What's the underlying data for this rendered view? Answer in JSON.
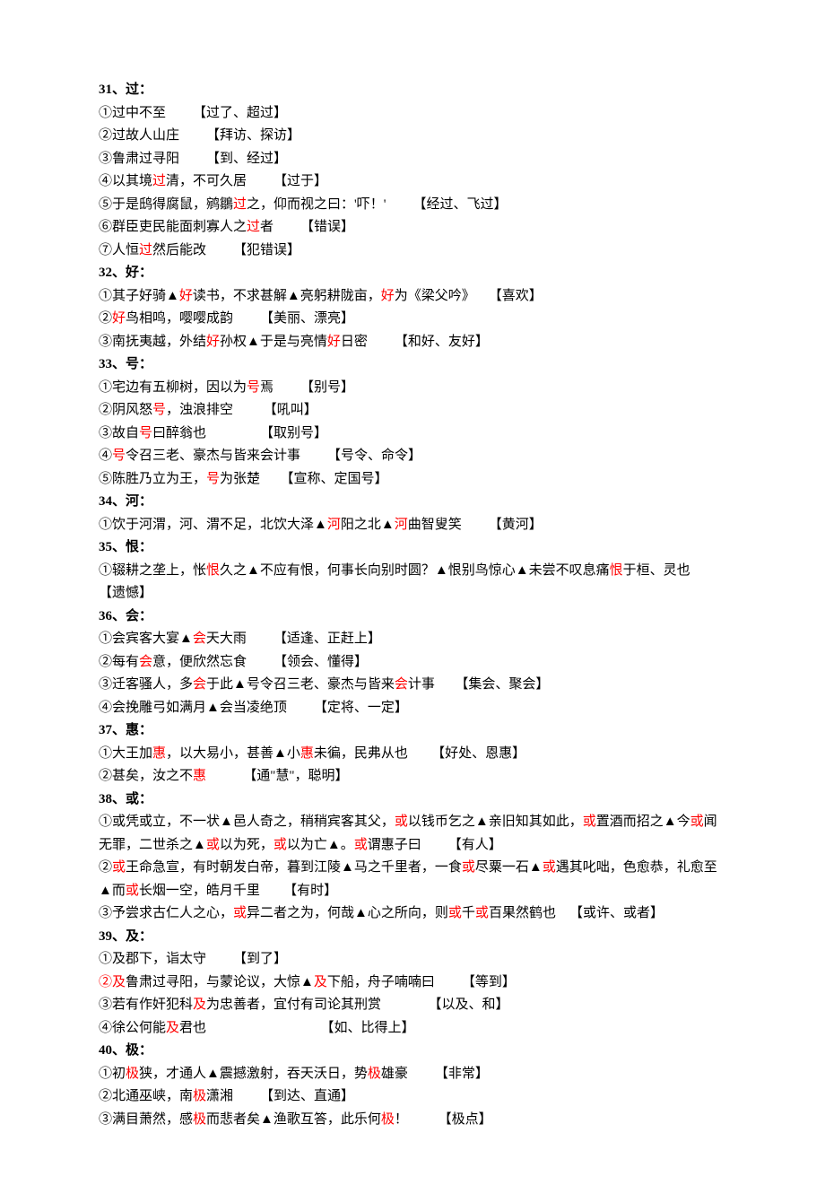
{
  "entries": [
    {
      "head": "31、过：",
      "lines": [
        [
          {
            "t": "①过中不至        【过了、超过】"
          }
        ],
        [
          {
            "t": "②过故人山庄        【拜访、探访】"
          }
        ],
        [
          {
            "t": "③鲁肃过寻阳        【到、经过】"
          }
        ],
        [
          {
            "t": "④以其境"
          },
          {
            "t": "过",
            "hl": true
          },
          {
            "t": "清，不可久居        【过于】"
          }
        ],
        [
          {
            "t": "⑤于是鸱得腐鼠，鹓鶵"
          },
          {
            "t": "过",
            "hl": true
          },
          {
            "t": "之，仰而视之曰：'吓！'        【经过、飞过】"
          }
        ],
        [
          {
            "t": "⑥群臣吏民能面刺寡人之"
          },
          {
            "t": "过",
            "hl": true
          },
          {
            "t": "者        【错误】"
          }
        ],
        [
          {
            "t": "⑦人恒"
          },
          {
            "t": "过",
            "hl": true
          },
          {
            "t": "然后能改        【犯错误】"
          }
        ]
      ]
    },
    {
      "head": "32、好：",
      "lines": [
        [
          {
            "t": "①其子好骑▲"
          },
          {
            "t": "好",
            "hl": true
          },
          {
            "t": "读书，不求甚解▲亮躬耕陇亩，"
          },
          {
            "t": "好",
            "hl": true
          },
          {
            "t": "为《梁父吟》    【喜欢】"
          }
        ],
        [
          {
            "t": "②"
          },
          {
            "t": "好",
            "hl": true
          },
          {
            "t": "鸟相鸣，嘤嘤成韵        【美丽、漂亮】"
          }
        ],
        [
          {
            "t": "③南抚夷越，外结"
          },
          {
            "t": "好",
            "hl": true
          },
          {
            "t": "孙权▲于是与亮情"
          },
          {
            "t": "好",
            "hl": true
          },
          {
            "t": "日密        【和好、友好】"
          }
        ]
      ]
    },
    {
      "head": "33、号：",
      "lines": [
        [
          {
            "t": "①宅边有五柳树，因以为"
          },
          {
            "t": "号",
            "hl": true
          },
          {
            "t": "焉        【别号】"
          }
        ],
        [
          {
            "t": "②阴风怒"
          },
          {
            "t": "号",
            "hl": true
          },
          {
            "t": "，浊浪排空         【吼叫】"
          }
        ],
        [
          {
            "t": "③故自"
          },
          {
            "t": "号",
            "hl": true
          },
          {
            "t": "曰醉翁也                【取别号】"
          }
        ],
        [
          {
            "t": "④"
          },
          {
            "t": "号",
            "hl": true
          },
          {
            "t": "令召三老、豪杰与皆来会计事        【号令、命令】"
          }
        ],
        [
          {
            "t": "⑤陈胜乃立为王，"
          },
          {
            "t": "号",
            "hl": true
          },
          {
            "t": "为张楚      【宣称、定国号】"
          }
        ]
      ]
    },
    {
      "head": "34、河：",
      "lines": [
        [
          {
            "t": "①饮于河渭，河、渭不足，北饮大泽▲"
          },
          {
            "t": "河",
            "hl": true
          },
          {
            "t": "阳之北▲"
          },
          {
            "t": "河",
            "hl": true
          },
          {
            "t": "曲智叟笑        【黄河】"
          }
        ]
      ]
    },
    {
      "head": "35、恨：",
      "lines": [
        [
          {
            "t": "①辍耕之垄上，怅"
          },
          {
            "t": "恨",
            "hl": true
          },
          {
            "t": "久之▲不应有恨，何事长向别时圆？▲恨别鸟惊心▲未尝不叹息痛"
          },
          {
            "t": "恨",
            "hl": true
          },
          {
            "t": "于桓、灵也     【遗憾】"
          }
        ]
      ]
    },
    {
      "head": "36、会：",
      "lines": [
        [
          {
            "t": "①会宾客大宴▲"
          },
          {
            "t": "会",
            "hl": true
          },
          {
            "t": "天大雨        【适逢、正赶上】"
          }
        ],
        [
          {
            "t": "②每有"
          },
          {
            "t": "会",
            "hl": true
          },
          {
            "t": "意，便欣然忘食        【领会、懂得】"
          }
        ],
        [
          {
            "t": "③迁客骚人，多"
          },
          {
            "t": "会",
            "hl": true
          },
          {
            "t": "于此▲号令召三老、豪杰与皆来"
          },
          {
            "t": "会",
            "hl": true
          },
          {
            "t": "计事      【集会、聚会】"
          }
        ],
        [
          {
            "t": "④会挽雕弓如满月▲会当凌绝顶        【定将、一定】"
          }
        ]
      ]
    },
    {
      "head": "37、惠：",
      "lines": [
        [
          {
            "t": "①大王加"
          },
          {
            "t": "惠",
            "hl": true
          },
          {
            "t": "，以大易小，甚善▲小"
          },
          {
            "t": "惠",
            "hl": true
          },
          {
            "t": "未徧，民弗从也       【好处、恩惠】"
          }
        ],
        [
          {
            "t": "②甚矣，汝之不"
          },
          {
            "t": "惠",
            "hl": true
          },
          {
            "t": "           【通\"慧\"，聪明】"
          }
        ]
      ]
    },
    {
      "head": "38、或：",
      "lines": [
        [
          {
            "t": "①或凭或立，不一状▲邑人奇之，稍稍宾客其父，"
          },
          {
            "t": "或",
            "hl": true
          },
          {
            "t": "以钱币乞之▲亲旧知其如此，"
          },
          {
            "t": "或",
            "hl": true
          },
          {
            "t": "置酒而招之▲今"
          },
          {
            "t": "或",
            "hl": true
          },
          {
            "t": "闻无罪，二世杀之▲"
          },
          {
            "t": "或",
            "hl": true
          },
          {
            "t": "以为死，"
          },
          {
            "t": "或",
            "hl": true
          },
          {
            "t": "以为亡▲。"
          },
          {
            "t": "或",
            "hl": true
          },
          {
            "t": "谓惠子曰        【有人】"
          }
        ],
        [
          {
            "t": "②"
          },
          {
            "t": "或",
            "hl": true
          },
          {
            "t": "王命急宣，有时朝发白帝，暮到江陵▲马之千里者，一食"
          },
          {
            "t": "或",
            "hl": true
          },
          {
            "t": "尽粟一石▲"
          },
          {
            "t": "或",
            "hl": true
          },
          {
            "t": "遇其叱咄，色愈恭，礼愈至▲而"
          },
          {
            "t": "或",
            "hl": true
          },
          {
            "t": "长烟一空，皓月千里       【有时】"
          }
        ],
        [
          {
            "t": "③予尝求古仁人之心，"
          },
          {
            "t": "或",
            "hl": true
          },
          {
            "t": "异二者之为，何哉▲心之所向，则"
          },
          {
            "t": "或",
            "hl": true
          },
          {
            "t": "千"
          },
          {
            "t": "或",
            "hl": true
          },
          {
            "t": "百果然鹤也    【或许、或者】"
          }
        ]
      ]
    },
    {
      "head": "39、及：",
      "lines": [
        [
          {
            "t": "①及郡下，诣太守        【到了】"
          }
        ],
        [
          {
            "t": "②及",
            "hl": true
          },
          {
            "t": "鲁肃过寻阳，与蒙论议，大惊▲"
          },
          {
            "t": "及",
            "hl": true
          },
          {
            "t": "下船，舟子喃喃曰        【等到】"
          }
        ],
        [
          {
            "t": "③若有作奸犯科"
          },
          {
            "t": "及",
            "hl": true
          },
          {
            "t": "为忠善者，宜付有司论其刑赏              【以及、和】"
          }
        ],
        [
          {
            "t": "④徐公何能"
          },
          {
            "t": "及",
            "hl": true
          },
          {
            "t": "君也                                  【如、比得上】"
          }
        ]
      ]
    },
    {
      "head": "40、极：",
      "lines": [
        [
          {
            "t": "①初"
          },
          {
            "t": "极",
            "hl": true
          },
          {
            "t": "狭，才通人▲震撼激射，吞天沃日，势"
          },
          {
            "t": "极",
            "hl": true
          },
          {
            "t": "雄豪        【非常】"
          }
        ],
        [
          {
            "t": "②北通巫峡，南"
          },
          {
            "t": "极",
            "hl": true
          },
          {
            "t": "潇湘        【到达、直通】"
          }
        ],
        [
          {
            "t": "③满目萧然，感"
          },
          {
            "t": "极",
            "hl": true
          },
          {
            "t": "而悲者矣▲渔歌互答，此乐何"
          },
          {
            "t": "极",
            "hl": true
          },
          {
            "t": "！         【极点】"
          }
        ]
      ]
    }
  ]
}
